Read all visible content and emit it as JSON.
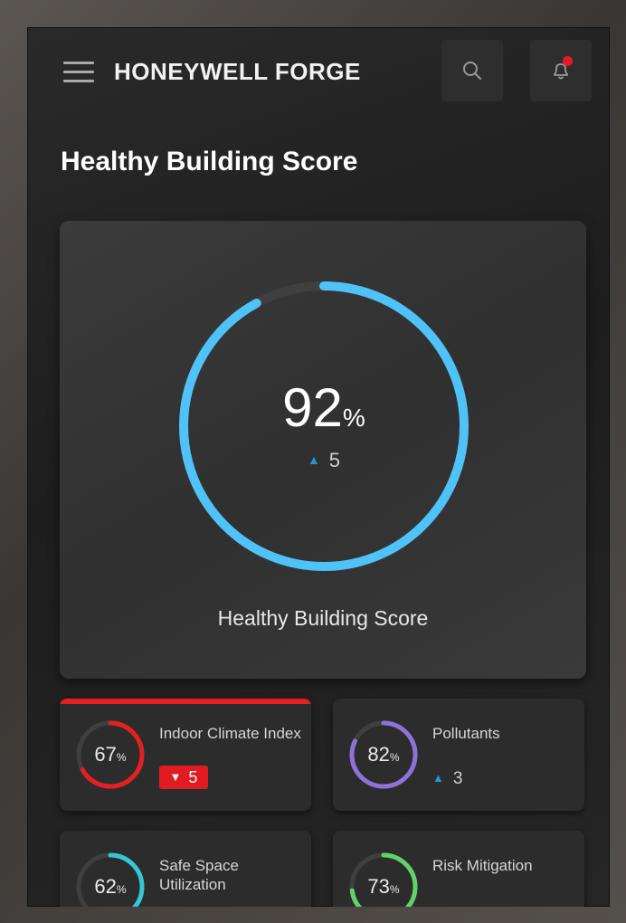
{
  "header": {
    "brand": "HONEYWELL FORGE",
    "menu_icon": "hamburger-menu-icon",
    "search_icon": "search-icon",
    "notification_icon": "bell-icon"
  },
  "page": {
    "title": "Healthy Building Score"
  },
  "score": {
    "value": "92",
    "unit": "%",
    "delta_direction": "up",
    "delta": "5",
    "label": "Healthy Building Score",
    "progress": 0.92,
    "color": "#4fc3f7"
  },
  "cards": [
    {
      "title": "Indoor Climate Index",
      "value": "67",
      "unit": "%",
      "progress": 0.67,
      "color": "#e51f22",
      "delta_direction": "down",
      "delta": "5",
      "alert": true
    },
    {
      "title": "Pollutants",
      "value": "82",
      "unit": "%",
      "progress": 0.82,
      "color": "#8e72d8",
      "delta_direction": "up",
      "delta": "3",
      "alert": false
    },
    {
      "title": "Safe Space Utilization",
      "value": "62",
      "unit": "%",
      "progress": 0.62,
      "color": "#35c6d8",
      "alert": false
    },
    {
      "title": "Risk Mitigation",
      "value": "73",
      "unit": "%",
      "progress": 0.73,
      "color": "#5fd36a",
      "alert": false
    }
  ],
  "colors": {
    "accent_blue": "#2196d9",
    "alert_red": "#e01b22",
    "notification_dot": "#e8182a"
  }
}
